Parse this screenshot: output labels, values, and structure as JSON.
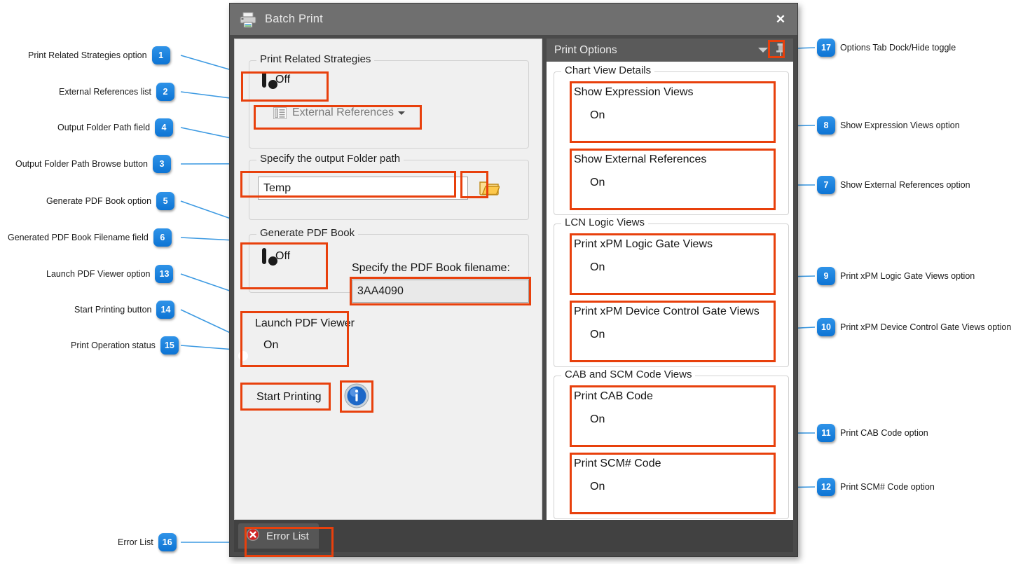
{
  "window": {
    "title": "Batch Print",
    "printer_icon": "printer-icon",
    "close_label": "✕"
  },
  "left_panel": {
    "groups": [
      {
        "label": "Print Related Strategies"
      },
      {
        "label": "Specify the output Folder path"
      },
      {
        "label": "Generate PDF Book"
      }
    ],
    "print_related_strategies": {
      "toggle_state": "Off",
      "external_references_label": "External References",
      "external_references_icon": "list-icon",
      "dropdown_icon": "chevron-down-icon"
    },
    "output_folder": {
      "value": "Temp",
      "browse_icon": "open-folder-icon"
    },
    "generate_pdf_book": {
      "toggle_state": "Off",
      "filename_caption": "Specify the PDF Book filename:",
      "filename_value": "3AA4090"
    },
    "launch_pdf_viewer": {
      "label": "Launch PDF Viewer",
      "toggle_state": "On"
    },
    "start_printing": {
      "label": "Start Printing",
      "status_icon": "info-icon"
    }
  },
  "right_panel": {
    "header": {
      "title": "Print Options",
      "caret_icon": "chevron-down-icon",
      "pin_icon": "pin-icon"
    },
    "groups": [
      {
        "label": "Chart View Details",
        "options": [
          {
            "label": "Show Expression Views",
            "state": "On"
          },
          {
            "label": "Show External References",
            "state": "On"
          }
        ]
      },
      {
        "label": "LCN Logic Views",
        "options": [
          {
            "label": "Print xPM Logic Gate Views",
            "state": "On"
          },
          {
            "label": "Print xPM Device Control Gate Views",
            "state": "On"
          }
        ]
      },
      {
        "label": "CAB and SCM Code Views",
        "options": [
          {
            "label": "Print CAB Code",
            "state": "On"
          },
          {
            "label": "Print SCM# Code",
            "state": "On"
          }
        ]
      }
    ]
  },
  "bottom_bar": {
    "error_list_label": "Error List",
    "error_icon": "error-icon"
  },
  "annotations": {
    "left": [
      {
        "num": "1",
        "text": "Print Related Strategies option"
      },
      {
        "num": "2",
        "text": "External References list"
      },
      {
        "num": "4",
        "text": "Output Folder Path field"
      },
      {
        "num": "3",
        "text": "Output Folder Path Browse button"
      },
      {
        "num": "5",
        "text": "Generate PDF Book option"
      },
      {
        "num": "6",
        "text": "Generated PDF Book Filename field"
      },
      {
        "num": "13",
        "text": "Launch PDF Viewer option"
      },
      {
        "num": "14",
        "text": "Start Printing button"
      },
      {
        "num": "15",
        "text": "Print Operation status"
      },
      {
        "num": "16",
        "text": "Error List"
      }
    ],
    "right": [
      {
        "num": "17",
        "text": "Options Tab Dock/Hide toggle"
      },
      {
        "num": "8",
        "text": "Show Expression Views option"
      },
      {
        "num": "7",
        "text": "Show External References option"
      },
      {
        "num": "9",
        "text": "Print xPM Logic Gate Views option"
      },
      {
        "num": "10",
        "text": "Print xPM Device Control Gate Views option"
      },
      {
        "num": "11",
        "text": "Print CAB Code option"
      },
      {
        "num": "12",
        "text": "Print SCM# Code option"
      }
    ]
  },
  "colors": {
    "accent_blue": "#0f6cbd",
    "highlight_red": "#e8400c",
    "callout_blue": "#1683e0",
    "leader_blue": "#3d9ae2"
  }
}
